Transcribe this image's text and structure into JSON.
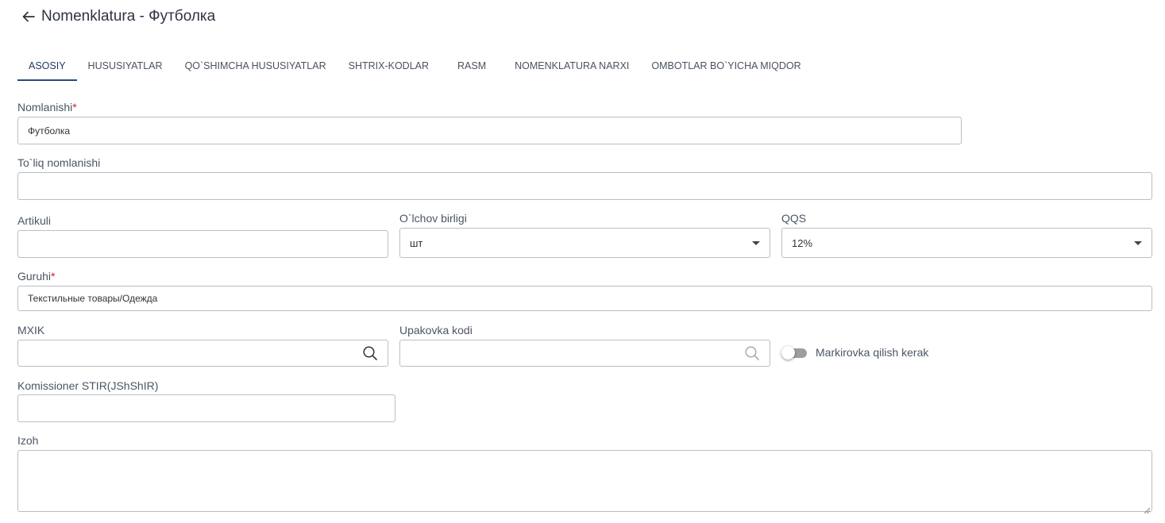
{
  "header": {
    "title": "Nomenklatura - Футболка"
  },
  "tabs": [
    {
      "label": "ASOSIY"
    },
    {
      "label": "HUSUSIYATLAR"
    },
    {
      "label": "QO`SHIMCHA HUSUSIYATLAR"
    },
    {
      "label": "SHTRIX-KODLAR"
    },
    {
      "label": "RASM"
    },
    {
      "label": "NOMENKLATURA NARXI"
    },
    {
      "label": "OMBOTLAR BO`YICHA MIQDOR"
    }
  ],
  "active_tab": "ASOSIY",
  "form": {
    "nomlanishi": {
      "label": "Nomlanishi",
      "value": "Футболка"
    },
    "toliq": {
      "label": "To`liq nomlanishi",
      "value": ""
    },
    "artikuli": {
      "label": "Artikuli",
      "value": ""
    },
    "olchov": {
      "label": "O`lchov birligi",
      "value": "шт"
    },
    "qqs": {
      "label": "QQS",
      "value": "12%"
    },
    "guruhi": {
      "label": "Guruhi",
      "value": "Текстильные товары/Одежда"
    },
    "mxik": {
      "label": "MXIK",
      "value": ""
    },
    "upakovka": {
      "label": "Upakovka kodi",
      "value": ""
    },
    "markirovka": {
      "label": "Markirovka qilish kerak",
      "enabled": false
    },
    "komissioner": {
      "label": "Komissioner STIR(JShShIR)",
      "value": ""
    },
    "izoh": {
      "label": "Izoh",
      "value": ""
    }
  },
  "required_marker": "*",
  "colors": {
    "accent": "#2a4a7f",
    "required": "#e0162b",
    "border": "#b9bec6"
  }
}
